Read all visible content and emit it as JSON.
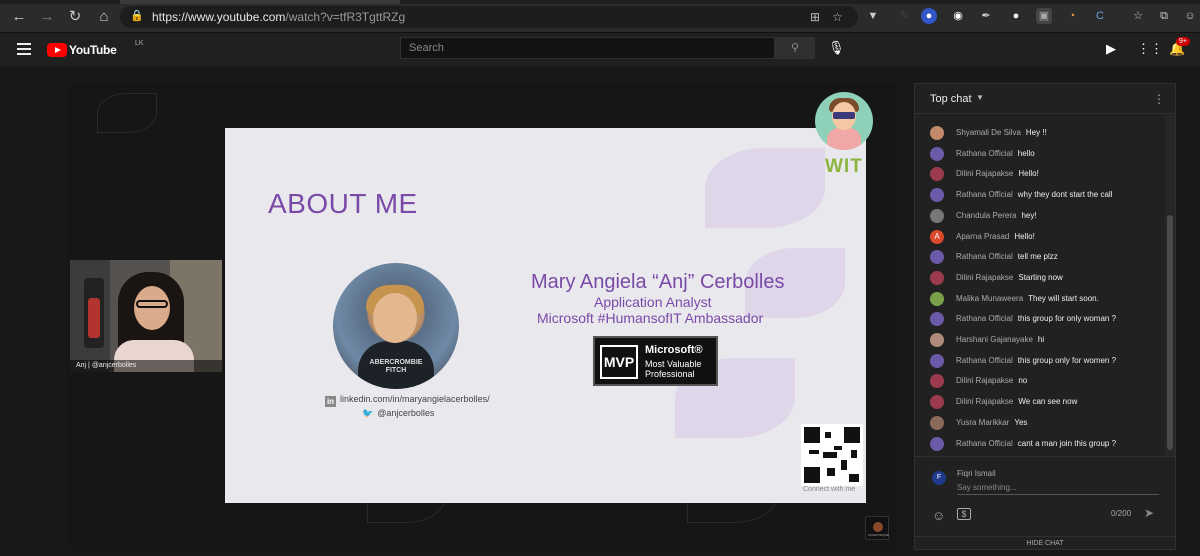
{
  "browser": {
    "url_host": "https://www.youtube.com",
    "url_path": "/watch?v=tfR3TgttRZg"
  },
  "header": {
    "logo_text": "YouTube",
    "country_code": "LK",
    "search_placeholder": "Search",
    "notification_count": "9+"
  },
  "slide": {
    "title": "ABOUT ME",
    "name": "Mary Angiela “Anj” Cerbolles",
    "role1": "Application Analyst",
    "role2": "Microsoft #HumansofIT Ambassador",
    "linkedin": "linkedin.com/in/maryangielacerbolles/",
    "twitter": "@anjcerbolles",
    "mvp_logo": "MVP",
    "mvp_line1": "Microsoft®",
    "mvp_line2": "Most Valuable",
    "mvp_line3": "Professional",
    "qr_caption": "Connect with me",
    "wit_logo": "WIT"
  },
  "webcam": {
    "caption": "Anj | @anjcerbolles"
  },
  "chat": {
    "mode": "Top chat",
    "messages": [
      {
        "author": "Shyamali De Silva",
        "text": "Hey !!",
        "color": "#c28a6a"
      },
      {
        "author": "Rathana Official",
        "text": "hello",
        "color": "#6a5aa8"
      },
      {
        "author": "Dilini Rajapakse",
        "text": "Hello!",
        "color": "#9b3b4d"
      },
      {
        "author": "Rathana Official",
        "text": "why they dont start the call",
        "color": "#6a5aa8"
      },
      {
        "author": "Chandula Perera",
        "text": "hey!",
        "color": "#777777"
      },
      {
        "author": "Aparna Prasad",
        "text": "Hello!",
        "color": "#d84a2a",
        "initial": "A"
      },
      {
        "author": "Rathana Official",
        "text": "tell me plzz",
        "color": "#6a5aa8"
      },
      {
        "author": "Dilini Rajapakse",
        "text": "Starting now",
        "color": "#9b3b4d"
      },
      {
        "author": "Malika Munaweera",
        "text": "They will start soon.",
        "color": "#7aa04a"
      },
      {
        "author": "Rathana Official",
        "text": "this group for only woman ?",
        "color": "#6a5aa8"
      },
      {
        "author": "Harshani Gajanayake",
        "text": "hi",
        "color": "#b08a7a"
      },
      {
        "author": "Rathana Official",
        "text": "this group only for women ?",
        "color": "#6a5aa8"
      },
      {
        "author": "Dilini Rajapakse",
        "text": "no",
        "color": "#9b3b4d"
      },
      {
        "author": "Dilini Rajapakse",
        "text": "We can see now",
        "color": "#9b3b4d"
      },
      {
        "author": "Yusra Marikkar",
        "text": "Yes",
        "color": "#8a6a5a"
      },
      {
        "author": "Rathana Official",
        "text": "cant a man join this group ?",
        "color": "#6a5aa8"
      }
    ],
    "current_user": "Fiqri Ismail",
    "input_placeholder": "Say something...",
    "char_count": "0/200",
    "hide_label": "HIDE CHAT"
  }
}
